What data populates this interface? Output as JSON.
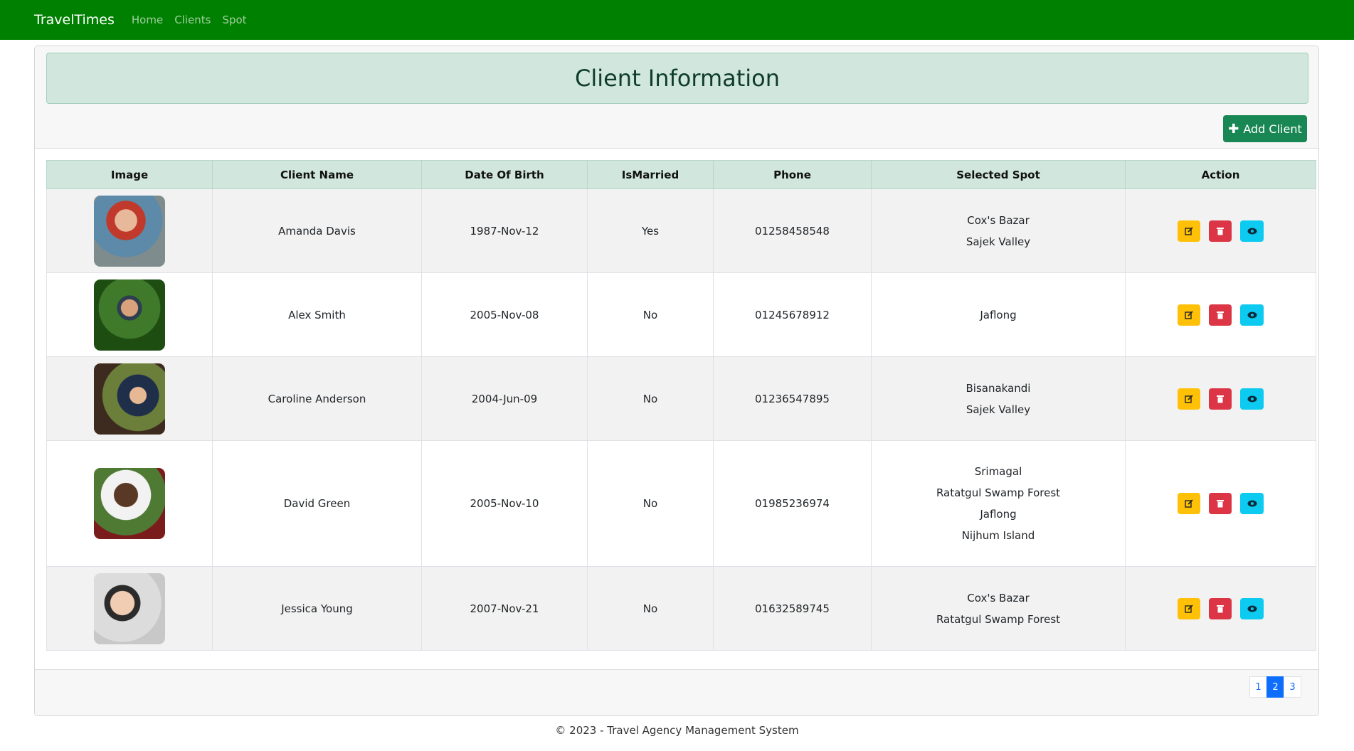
{
  "nav": {
    "brand": "TravelTimes",
    "links": [
      "Home",
      "Clients",
      "Spot"
    ]
  },
  "header": {
    "title": "Client Information",
    "add_button": "Add Client"
  },
  "table": {
    "columns": [
      "Image",
      "Client Name",
      "Date Of Birth",
      "IsMarried",
      "Phone",
      "Selected Spot",
      "Action"
    ],
    "rows": [
      {
        "name": "Amanda Davis",
        "dob": "1987-Nov-12",
        "married": "Yes",
        "phone": "01258458548",
        "spots": [
          "Cox's Bazar",
          "Sajek Valley"
        ]
      },
      {
        "name": "Alex Smith",
        "dob": "2005-Nov-08",
        "married": "No",
        "phone": "01245678912",
        "spots": [
          "Jaflong"
        ]
      },
      {
        "name": "Caroline Anderson",
        "dob": "2004-Jun-09",
        "married": "No",
        "phone": "01236547895",
        "spots": [
          "Bisanakandi",
          "Sajek Valley"
        ]
      },
      {
        "name": "David Green",
        "dob": "2005-Nov-10",
        "married": "No",
        "phone": "01985236974",
        "spots": [
          "Srimagal",
          "Ratatgul Swamp Forest",
          "Jaflong",
          "Nijhum Island"
        ]
      },
      {
        "name": "Jessica Young",
        "dob": "2007-Nov-21",
        "married": "No",
        "phone": "01632589745",
        "spots": [
          "Cox's Bazar",
          "Ratatgul Swamp Forest"
        ]
      }
    ]
  },
  "pagination": {
    "pages": [
      "1",
      "2",
      "3"
    ],
    "active": "2"
  },
  "footer": {
    "text": "© 2023 - Travel Agency Management System"
  },
  "colors": {
    "navbar": "#008000",
    "header_bg": "#d1e7dd",
    "add_button": "#198754",
    "edit": "#ffc107",
    "delete": "#dc3545",
    "view": "#0dcaf0",
    "page_active": "#0d6efd"
  },
  "icons": {
    "add": "plus-icon",
    "edit": "edit-icon",
    "delete": "trash-icon",
    "view": "eye-icon"
  }
}
